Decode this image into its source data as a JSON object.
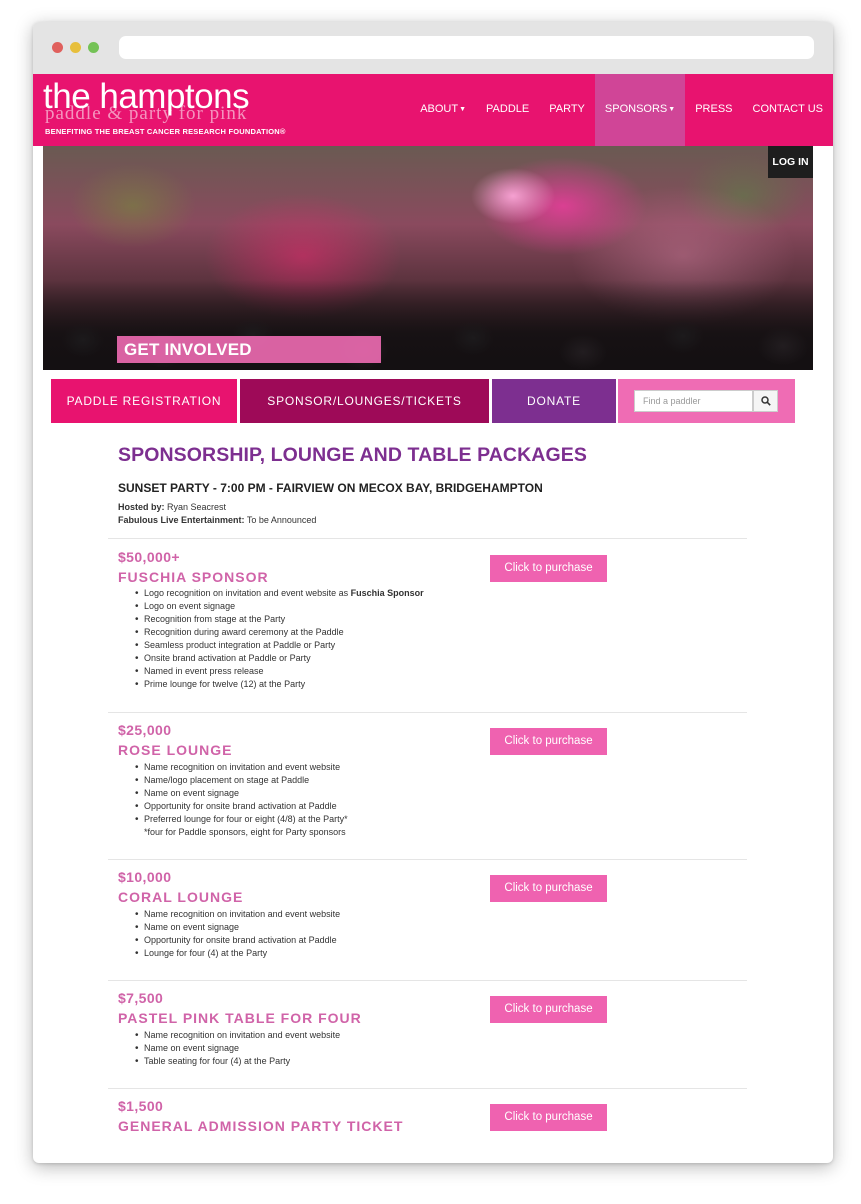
{
  "brand": {
    "line1": "the hamptons",
    "line2": "paddle & party for pink",
    "line3": "BENEFITING THE BREAST CANCER RESEARCH FOUNDATION®"
  },
  "nav": {
    "items": [
      {
        "label": "ABOUT",
        "dropdown": true
      },
      {
        "label": "PADDLE",
        "dropdown": false
      },
      {
        "label": "PARTY",
        "dropdown": false
      },
      {
        "label": "SPONSORS",
        "dropdown": true,
        "active": true
      },
      {
        "label": "PRESS",
        "dropdown": false
      },
      {
        "label": "CONTACT US",
        "dropdown": false
      }
    ]
  },
  "hero": {
    "login": "LOG IN",
    "banner": "GET INVOLVED"
  },
  "tabs": {
    "paddle": "PADDLE REGISTRATION",
    "sponsor": "SPONSOR/LOUNGES/TICKETS",
    "donate": "DONATE",
    "search_placeholder": "Find a paddler"
  },
  "content": {
    "title": "SPONSORSHIP, LOUNGE AND TABLE PACKAGES",
    "subtitle": "SUNSET PARTY - 7:00 PM - FAIRVIEW ON MECOX BAY, BRIDGEHAMPTON",
    "host_label": "Hosted by:",
    "host_value": "Ryan Seacrest",
    "ent_label": "Fabulous Live Entertainment:",
    "ent_value": "To be Announced",
    "buy_label": "Click to purchase"
  },
  "packages": [
    {
      "price": "$50,000+",
      "name": "FUSCHIA SPONSOR",
      "benefit_first_prefix": "Logo recognition on invitation and event website as ",
      "benefit_first_bold": "Fuschia Sponsor",
      "benefits": [
        "Logo on event signage",
        "Recognition from stage at the Party",
        "Recognition during award ceremony at the Paddle",
        "Seamless product integration at Paddle or Party",
        "Onsite brand activation at Paddle or Party",
        "Named in event press release",
        "Prime lounge for twelve (12) at the Party"
      ]
    },
    {
      "price": "$25,000",
      "name": "ROSE LOUNGE",
      "benefits": [
        "Name recognition on invitation and event website",
        "Name/logo placement on stage at Paddle",
        "Name on event signage",
        "Opportunity for onsite brand activation at Paddle",
        "Preferred lounge for four or eight (4/8) at the Party*"
      ],
      "note": "*four for Paddle sponsors, eight for Party sponsors"
    },
    {
      "price": "$10,000",
      "name": "CORAL LOUNGE",
      "benefits": [
        "Name recognition on invitation and event website",
        "Name on event signage",
        "Opportunity for onsite brand activation at Paddle",
        "Lounge for four (4) at the Party"
      ]
    },
    {
      "price": "$7,500",
      "name": "PASTEL PINK TABLE FOR FOUR",
      "benefits": [
        "Name recognition on invitation and event website",
        "Name on event signage",
        "Table seating for four (4) at the Party"
      ]
    },
    {
      "price": "$1,500",
      "name": "GENERAL ADMISSION PARTY TICKET",
      "benefits": []
    }
  ],
  "colors": {
    "brand_pink": "#e8136f",
    "sponsor_tab": "#9e0a58",
    "donate_tab": "#7d2f90",
    "package_pink": "#d063a8",
    "button_pink": "#ef62b0"
  }
}
